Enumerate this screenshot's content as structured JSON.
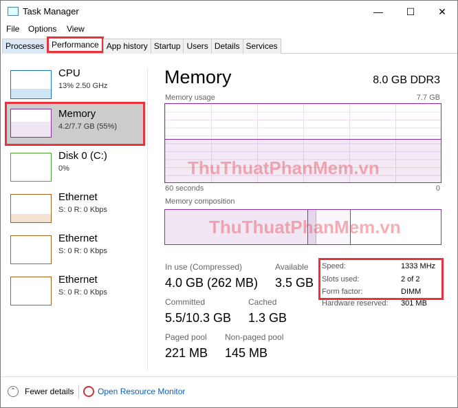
{
  "window": {
    "title": "Task Manager",
    "minimize": "—",
    "maximize": "☐",
    "close": "✕"
  },
  "menu": [
    "File",
    "Options",
    "View"
  ],
  "tabs": [
    "Processes",
    "Performance",
    "App history",
    "Startup",
    "Users",
    "Details",
    "Services"
  ],
  "sidebar": [
    {
      "name": "CPU",
      "sub": "13%  2.50 GHz"
    },
    {
      "name": "Memory",
      "sub": "4.2/7.7 GB (55%)"
    },
    {
      "name": "Disk 0 (C:)",
      "sub": "0%"
    },
    {
      "name": "Ethernet",
      "sub": "S: 0  R: 0 Kbps"
    },
    {
      "name": "Ethernet",
      "sub": "S: 0  R: 0 Kbps"
    },
    {
      "name": "Ethernet",
      "sub": "S: 0  R: 0 Kbps"
    }
  ],
  "main": {
    "title": "Memory",
    "spec": "8.0 GB DDR3",
    "usage_label": "Memory usage",
    "usage_max": "7.7 GB",
    "time_left": "60 seconds",
    "time_right": "0",
    "composition_label": "Memory composition",
    "usage_percent": 55
  },
  "stats": {
    "in_use_label": "In use (Compressed)",
    "in_use": "4.0 GB (262 MB)",
    "available_label": "Available",
    "available": "3.5 GB",
    "committed_label": "Committed",
    "committed": "5.5/10.3 GB",
    "cached_label": "Cached",
    "cached": "1.3 GB",
    "paged_label": "Paged pool",
    "paged": "221 MB",
    "nonpaged_label": "Non-paged pool",
    "nonpaged": "145 MB"
  },
  "hardware": [
    {
      "k": "Speed:",
      "v": "1333 MHz"
    },
    {
      "k": "Slots used:",
      "v": "2 of 2"
    },
    {
      "k": "Form factor:",
      "v": "DIMM"
    },
    {
      "k": "Hardware reserved:",
      "v": "301 MB"
    }
  ],
  "footer": {
    "fewer": "Fewer details",
    "monitor": "Open Resource Monitor"
  },
  "watermark": "ThuThuatPhanMem.vn",
  "colors": {
    "memory": "#8b2fa6",
    "cpu": "#1a7ab8",
    "disk": "#4da833",
    "ethernet": "#a7621b",
    "highlight": "#e8323c"
  }
}
